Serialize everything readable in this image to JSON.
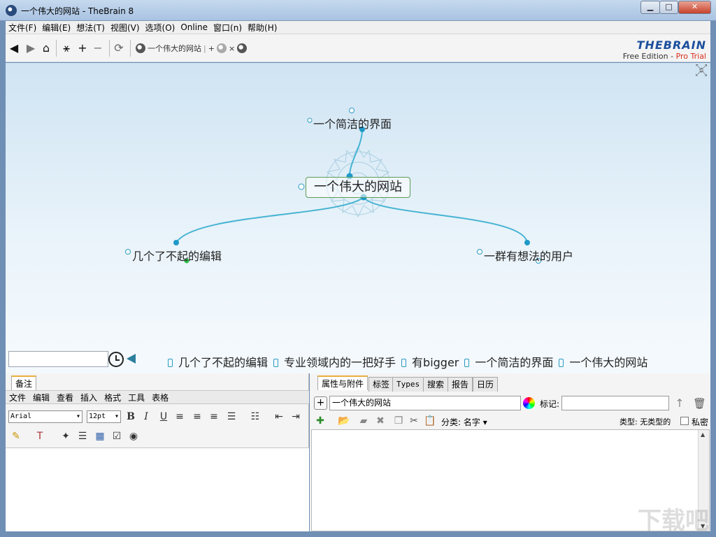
{
  "window": {
    "title": "一个伟大的网站 - TheBrain 8",
    "min_label": "▁",
    "max_label": "□",
    "close_label": "✕"
  },
  "menu": [
    "文件(F)",
    "编辑(E)",
    "想法(T)",
    "视图(V)",
    "选项(O)",
    "Online",
    "窗口(n)",
    "帮助(H)"
  ],
  "toolbar": {
    "back_icon": "◀",
    "forward_icon": "▶",
    "home_icon": "⌂",
    "link_icon": "⚹",
    "add_icon": "+",
    "remove_icon": "−",
    "refresh_icon": "⟳",
    "crumb_current": "一个伟大的网站",
    "crumb_add": "+",
    "crumb_close": "×"
  },
  "brand": {
    "logo": "THEBRAIN",
    "edition": "Free Edition - ",
    "pro": "Pro Trial"
  },
  "plex": {
    "active_thought": "一个伟大的网站",
    "parent_thought": "一个简洁的界面",
    "child_left": "几个了不起的编辑",
    "child_right": "一群有想法的用户"
  },
  "history": {
    "search_value": "",
    "items": [
      "几个了不起的编辑",
      "专业领域内的一把好手",
      "有bigger",
      "一个简洁的界面",
      "一个伟大的网站"
    ]
  },
  "notes": {
    "tab": "备注",
    "menu": [
      "文件",
      "编辑",
      "查看",
      "插入",
      "格式",
      "工具",
      "表格"
    ],
    "font": "Arial",
    "size": "12pt"
  },
  "props": {
    "tabs": [
      "属性与附件",
      "标签",
      "Types",
      "搜索",
      "报告",
      "日历"
    ],
    "name_value": "一个伟大的网站",
    "tag_label": "标记:",
    "category_label": "分类: 名字",
    "type_label": "类型: 无类型的",
    "private_label": "私密"
  },
  "watermark": "下载吧"
}
